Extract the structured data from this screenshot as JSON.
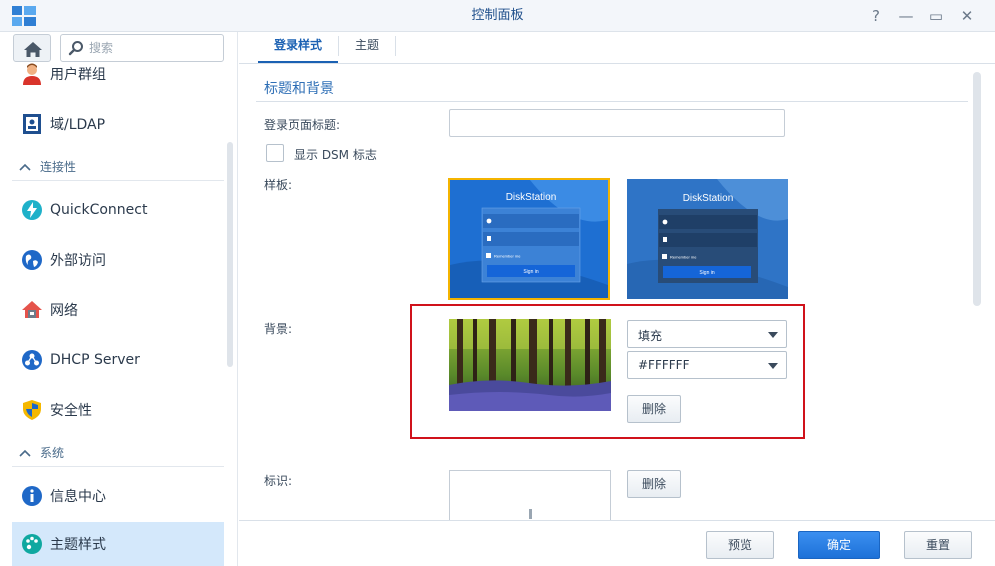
{
  "window": {
    "title": "控制面板",
    "help": "?",
    "minimize": "—",
    "maximize": "▭",
    "close": "✕"
  },
  "sidebar": {
    "search_placeholder": "搜索",
    "items": [
      {
        "label": "用户群组",
        "icon": "user-group-icon"
      },
      {
        "label": "域/LDAP",
        "icon": "domain-ldap-icon"
      },
      {
        "section": "连接性"
      },
      {
        "label": "QuickConnect",
        "icon": "quickconnect-icon"
      },
      {
        "label": "外部访问",
        "icon": "external-access-icon"
      },
      {
        "label": "网络",
        "icon": "network-icon"
      },
      {
        "label": "DHCP Server",
        "icon": "dhcp-server-icon"
      },
      {
        "label": "安全性",
        "icon": "security-shield-icon"
      },
      {
        "section": "系统"
      },
      {
        "label": "信息中心",
        "icon": "info-center-icon"
      },
      {
        "label": "主题样式",
        "icon": "theme-palette-icon",
        "active": true
      }
    ]
  },
  "tabs": [
    {
      "label": "登录样式",
      "active": true
    },
    {
      "label": "主题",
      "active": false
    }
  ],
  "main": {
    "section_title": "标题和背景",
    "login_title_label": "登录页面标题:",
    "login_title_value": "",
    "show_dsm_logo_label": "显示 DSM 标志",
    "show_dsm_logo_checked": false,
    "template_label": "样板:",
    "templates": [
      {
        "brand": "DiskStation",
        "remember": "Remember me",
        "sign_in": "Sign in",
        "selected": true
      },
      {
        "brand": "DiskStation",
        "remember": "Remember me",
        "sign_in": "Sign in",
        "selected": false
      }
    ],
    "background_label": "背景:",
    "fill_mode": "填充",
    "bg_color": "#FFFFFF",
    "bg_delete": "删除",
    "logo_label": "标识:",
    "logo_delete": "删除"
  },
  "footer": {
    "preview": "预览",
    "ok": "确定",
    "reset": "重置"
  },
  "colors": {
    "accent": "#1b61b3",
    "highlight": "#d0121b",
    "selected_template": "#f4b400"
  }
}
